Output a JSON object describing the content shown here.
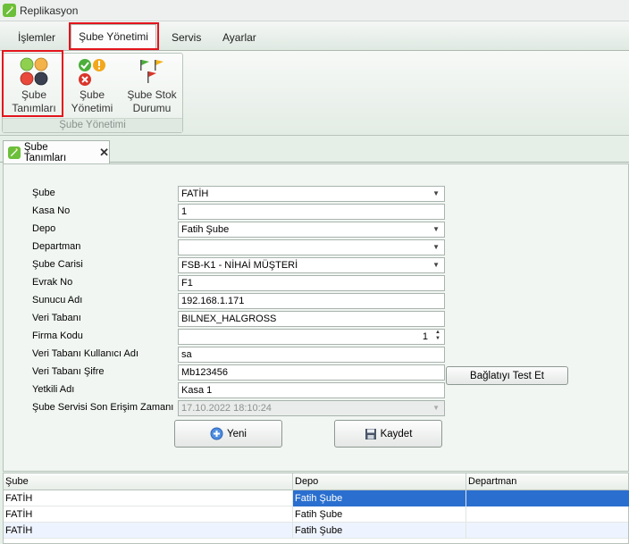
{
  "window": {
    "title": "Replikasyon"
  },
  "menu": {
    "tabs": [
      "İşlemler",
      "Şube Yönetimi",
      "Servis",
      "Ayarlar"
    ]
  },
  "ribbon": {
    "group_label": "Şube Yönetimi",
    "buttons": [
      {
        "line1": "Şube",
        "line2": "Tanımları"
      },
      {
        "line1": "Şube",
        "line2": "Yönetimi"
      },
      {
        "line1": "Şube Stok",
        "line2": "Durumu"
      }
    ]
  },
  "doc_tab": {
    "label": "Şube Tanımları"
  },
  "form": {
    "fields": [
      {
        "label": "Şube",
        "value": "FATİH"
      },
      {
        "label": "Kasa No",
        "value": "1"
      },
      {
        "label": "Depo",
        "value": "Fatih Şube"
      },
      {
        "label": "Departman",
        "value": ""
      },
      {
        "label": "Şube Carisi",
        "value": "FSB-K1 - NİHAİ MÜŞTERİ"
      },
      {
        "label": "Evrak No",
        "value": "F1"
      },
      {
        "label": "Sunucu Adı",
        "value": "192.168.1.171"
      },
      {
        "label": "Veri Tabanı",
        "value": "BILNEX_HALGROSS"
      },
      {
        "label": "Firma Kodu",
        "value": "1"
      },
      {
        "label": "Veri Tabanı Kullanıcı Adı",
        "value": "sa"
      },
      {
        "label": "Veri Tabanı Şifre",
        "value": "Mb123456"
      },
      {
        "label": "Yetkili Adı",
        "value": "Kasa 1"
      },
      {
        "label": "Şube Servisi Son Erişim Zamanı",
        "value": "17.10.2022 18:10:24"
      }
    ],
    "test_button": "Bağlatıyı Test Et",
    "new_button": "Yeni",
    "save_button": "Kaydet"
  },
  "grid": {
    "columns": [
      "Şube",
      "Depo",
      "Departman"
    ],
    "rows": [
      [
        "FATİH",
        "Fatih Şube",
        ""
      ],
      [
        "FATİH",
        "Fatih Şube",
        ""
      ],
      [
        "FATİH",
        "Fatih Şube",
        ""
      ]
    ]
  },
  "colors": {
    "accent_red": "#e3141c",
    "selection": "#2a6fcf"
  }
}
